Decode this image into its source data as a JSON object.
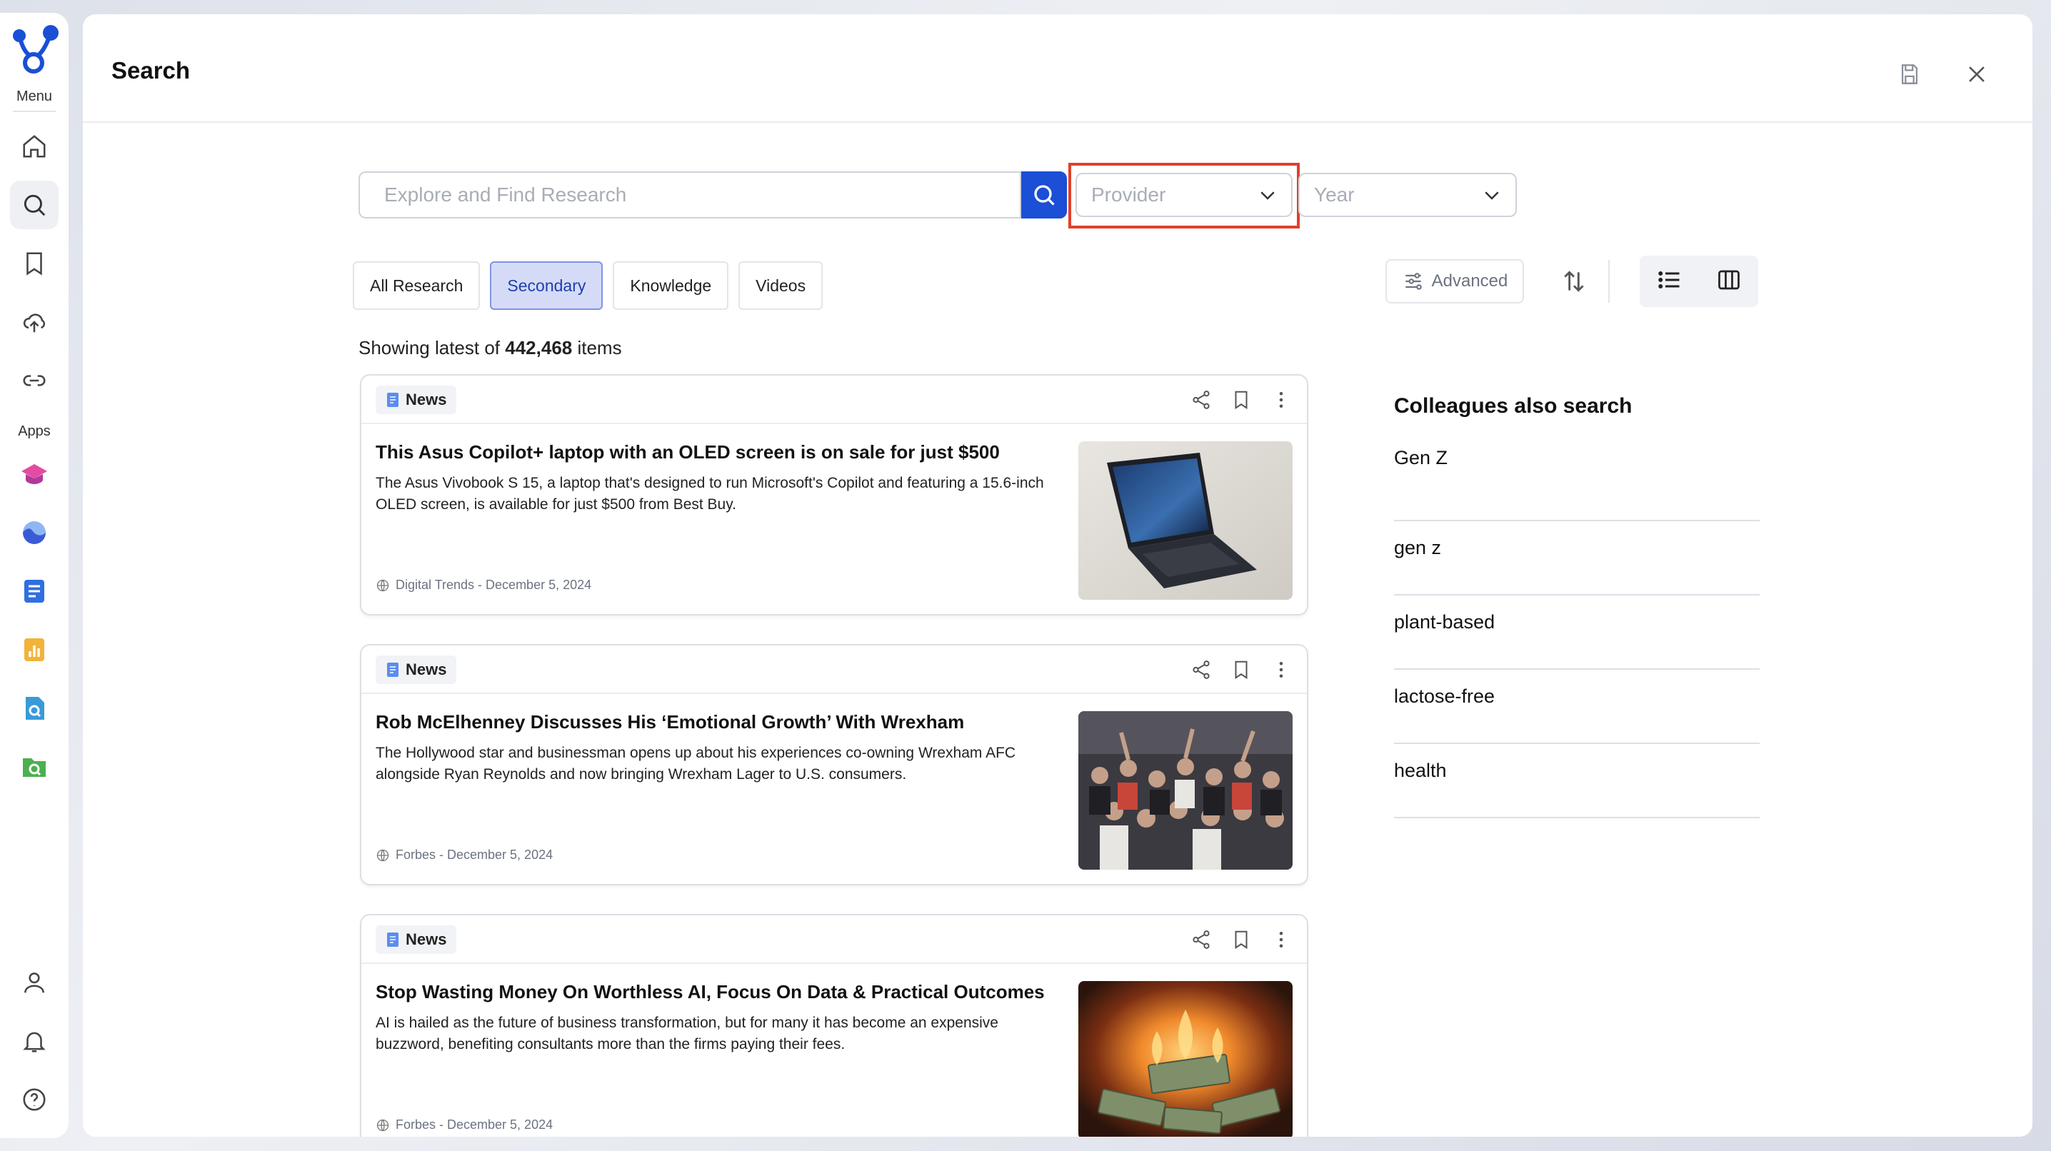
{
  "sidebar": {
    "menu_label": "Menu",
    "apps_label": "Apps",
    "nav": [
      "home-icon",
      "search-icon",
      "bookmark-icon",
      "upload-cloud-icon",
      "link-icon"
    ],
    "apps": [
      "graduation-cap-app-icon",
      "wave-app-icon",
      "document-app-icon",
      "chart-app-icon",
      "file-search-app-icon",
      "folder-search-app-icon"
    ],
    "bottom": [
      "user-icon",
      "bell-icon",
      "help-icon"
    ]
  },
  "header": {
    "title": "Search"
  },
  "search": {
    "placeholder": "Explore and Find Research",
    "provider_placeholder": "Provider",
    "year_placeholder": "Year"
  },
  "tabs": [
    {
      "label": "All Research",
      "active": false
    },
    {
      "label": "Secondary",
      "active": true
    },
    {
      "label": "Knowledge",
      "active": false
    },
    {
      "label": "Videos",
      "active": false
    }
  ],
  "tools": {
    "advanced_label": "Advanced"
  },
  "results": {
    "prefix": "Showing latest of",
    "count": "442,468",
    "suffix": "items"
  },
  "cards": [
    {
      "badge": "News",
      "title": "This Asus Copilot+ laptop with an OLED screen is on sale for just $500",
      "description": "The Asus Vivobook S 15, a laptop that's designed to run Microsoft's Copilot and featuring a 15.6-inch OLED screen, is available for just $500 from Best Buy.",
      "meta": "Digital Trends - December 5, 2024"
    },
    {
      "badge": "News",
      "title": "Rob McElhenney Discusses His ‘Emotional Growth’ With Wrexham",
      "description": "The Hollywood star and businessman opens up about his experiences co-owning Wrexham AFC alongside Ryan Reynolds and now bringing Wrexham Lager to U.S. consumers.",
      "meta": "Forbes - December 5, 2024"
    },
    {
      "badge": "News",
      "title": "Stop Wasting Money On Worthless AI, Focus On Data & Practical Outcomes",
      "description": "AI is hailed as the future of business transformation, but for many it has become an expensive buzzword, benefiting consultants more than the firms paying their fees.",
      "meta": "Forbes - December 5, 2024"
    }
  ],
  "colleagues": {
    "title": "Colleagues also search",
    "items": [
      "Gen Z",
      "gen z",
      "plant-based",
      "lactose-free",
      "health"
    ]
  },
  "colors": {
    "accent": "#1a4fd6",
    "highlight": "#e0402c",
    "active_tab_bg": "#d5dbf7"
  }
}
